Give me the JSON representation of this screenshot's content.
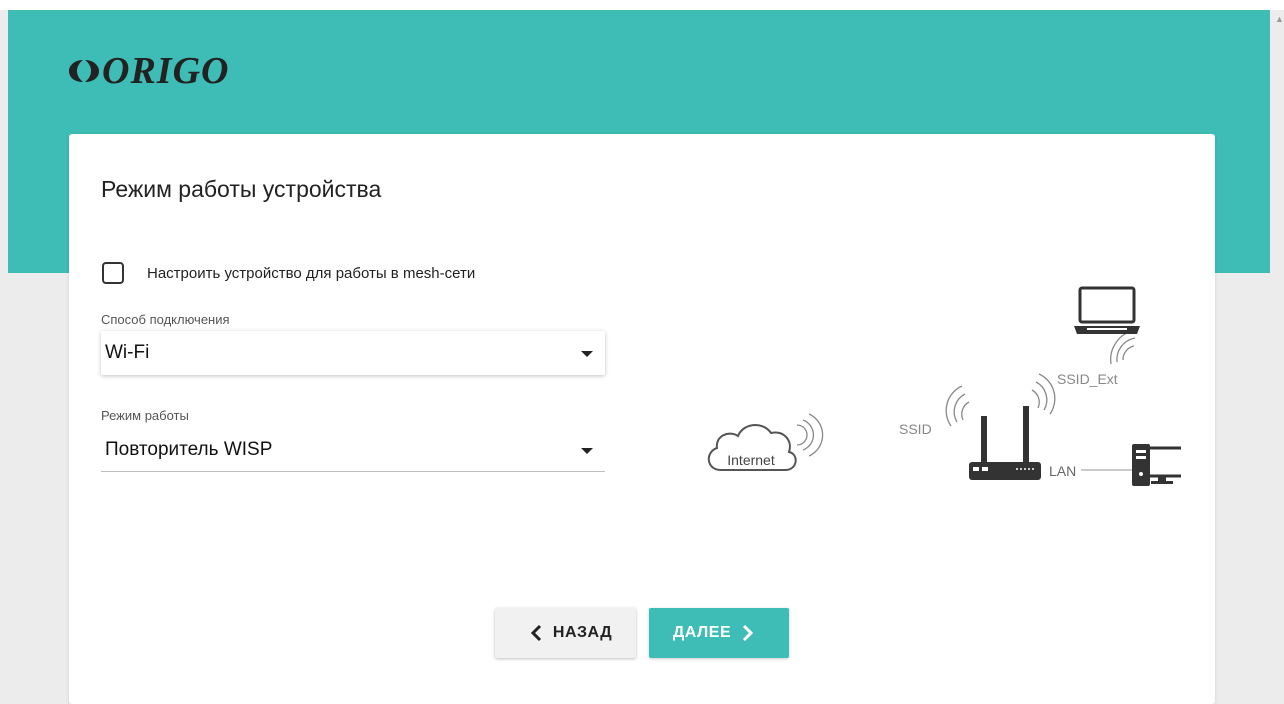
{
  "brand": {
    "name": "ORIGO",
    "color": "#3dbdb6"
  },
  "page": {
    "title": "Режим работы устройства"
  },
  "mesh": {
    "label": "Настроить устройство для работы в mesh-сети",
    "checked": false
  },
  "connection": {
    "label": "Способ подключения",
    "value": "Wi-Fi"
  },
  "mode": {
    "label": "Режим работы",
    "value": "Повторитель WISP"
  },
  "diagram": {
    "internet": "Internet",
    "ssid": "SSID",
    "ssid_ext": "SSID_Ext",
    "lan": "LAN"
  },
  "buttons": {
    "back": "НАЗАД",
    "next": "ДАЛЕЕ"
  },
  "icons": {
    "back": "chevron-left-icon",
    "next": "chevron-right-icon",
    "dropdown": "caret-down-icon"
  }
}
